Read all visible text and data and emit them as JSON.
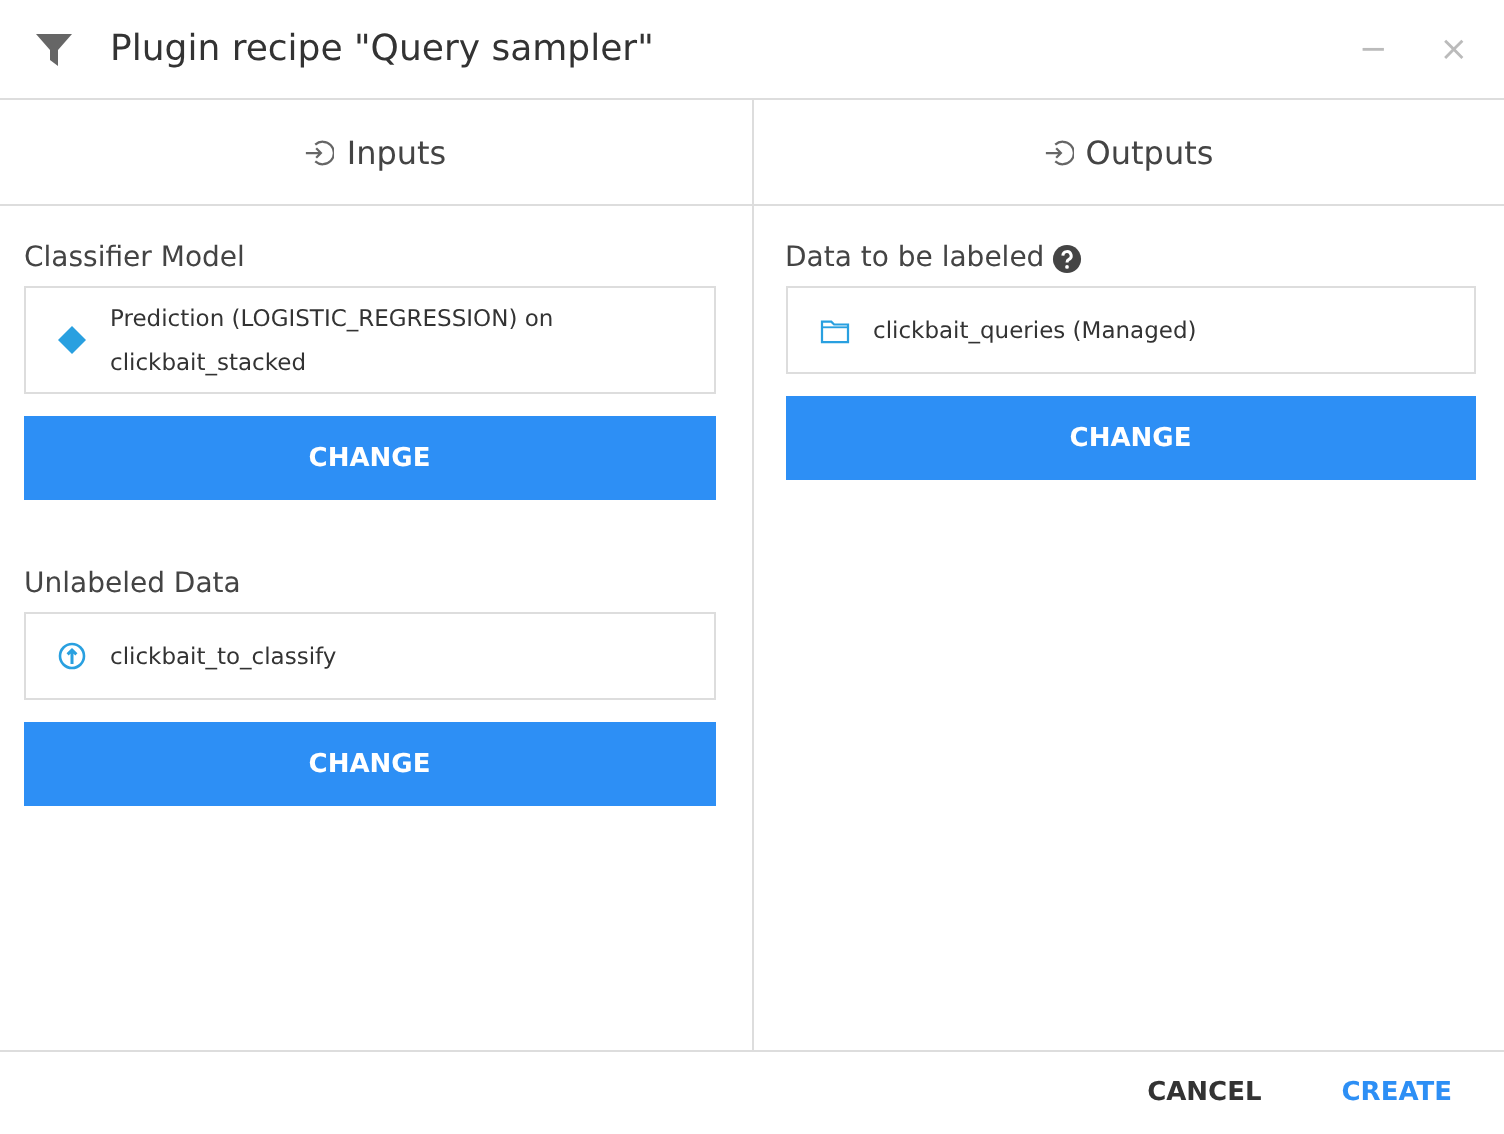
{
  "window": {
    "title": "Plugin recipe \"Query sampler\"",
    "minimize": "−",
    "close": "×"
  },
  "columns": [
    {
      "heading": "Inputs",
      "roles": [
        {
          "label": "Classifier Model",
          "help": false,
          "item": {
            "kind": "model",
            "text": "Prediction (LOGISTIC_REGRESSION) on clickbait_stacked"
          },
          "button": "CHANGE"
        },
        {
          "label": "Unlabeled Data",
          "help": false,
          "item": {
            "kind": "uploaded",
            "text": "clickbait_to_classify"
          },
          "button": "CHANGE"
        }
      ]
    },
    {
      "heading": "Outputs",
      "roles": [
        {
          "label": "Data to be labeled",
          "help": true,
          "item": {
            "kind": "managed",
            "text": "clickbait_queries (Managed)"
          },
          "button": "CHANGE"
        }
      ]
    }
  ],
  "footer": {
    "buttons": [
      {
        "label": "CANCEL",
        "primary": false
      },
      {
        "label": "CREATE",
        "primary": true
      }
    ]
  }
}
